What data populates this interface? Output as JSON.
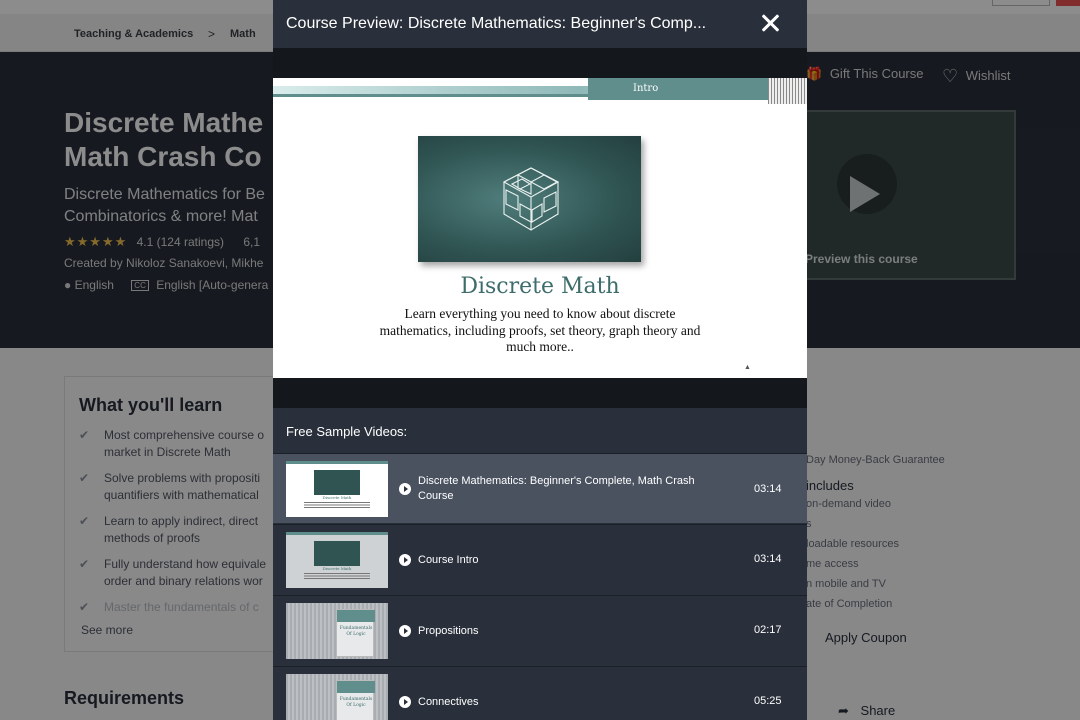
{
  "background": {
    "breadcrumb": [
      "Teaching & Academics",
      "Math"
    ],
    "breadcrumb_sep": ">",
    "hero": {
      "title": "Discrete Mathe… Math Crash Co…",
      "title_line1": "Discrete Mathe",
      "title_line2": "Math Crash Co",
      "subtitle_line1": "Discrete Mathematics for Be",
      "subtitle_line2": "Combinatorics & more! Mat",
      "stars": "★★★★★",
      "rating": "4.1 (124 ratings)",
      "students": "6,1",
      "creator": "Created by Nikoloz Sanakoevi, Mikhe",
      "language": "English",
      "captions": "English [Auto-genera",
      "cc": "CC",
      "gift": "Gift This Course",
      "wishlist": "Wishlist",
      "preview_label": "Preview this course"
    },
    "learn": {
      "title": "What you'll learn",
      "items": [
        [
          "Most comprehensive course o",
          "market in Discrete Math"
        ],
        [
          "Solve problems with propositi",
          "quantifiers with mathematical"
        ],
        [
          "Learn to apply indirect, direct",
          "methods of proofs"
        ],
        [
          "Fully understand how equivale",
          "order and binary relations wor"
        ],
        [
          "Master the fundamentals of c"
        ]
      ],
      "see_more": "See more"
    },
    "requirements": "Requirements",
    "sidebar": {
      "guarantee": "Day Money-Back Guarantee",
      "includes": "includes",
      "items": [
        "on-demand video",
        "s",
        "loadable resources",
        "me access",
        "n mobile and TV",
        "ate of Completion"
      ],
      "coupon": "Apply Coupon",
      "share": "Share"
    }
  },
  "modal": {
    "title": "Course Preview: Discrete Mathematics: Beginner's Comp...",
    "slide": {
      "intro": "Intro",
      "heading": "Discrete Math",
      "body": "Learn everything you need to know about discrete mathematics, including proofs, set theory, graph theory and much more.."
    },
    "free_label": "Free Sample Videos:",
    "videos": [
      {
        "title": "Discrete Mathematics: Beginner's Complete, Math Crash Course",
        "duration": "03:14",
        "active": true,
        "thumb_heading": "Discrete Math"
      },
      {
        "title": "Course Intro",
        "duration": "03:14",
        "active": false,
        "thumb_heading": "Discrete Math"
      },
      {
        "title": "Propositions",
        "duration": "02:17",
        "active": false,
        "thumb_heading": "Fundamentals Of Logic"
      },
      {
        "title": "Connectives",
        "duration": "05:25",
        "active": false,
        "thumb_heading": "Fundamentals Of Logic"
      }
    ]
  },
  "colors": {
    "hero_bg": "#29303b",
    "modal_bg": "#29303b",
    "active_row": "#4a5260",
    "slide_accent": "#3d6d6b",
    "star": "#f4c150"
  }
}
